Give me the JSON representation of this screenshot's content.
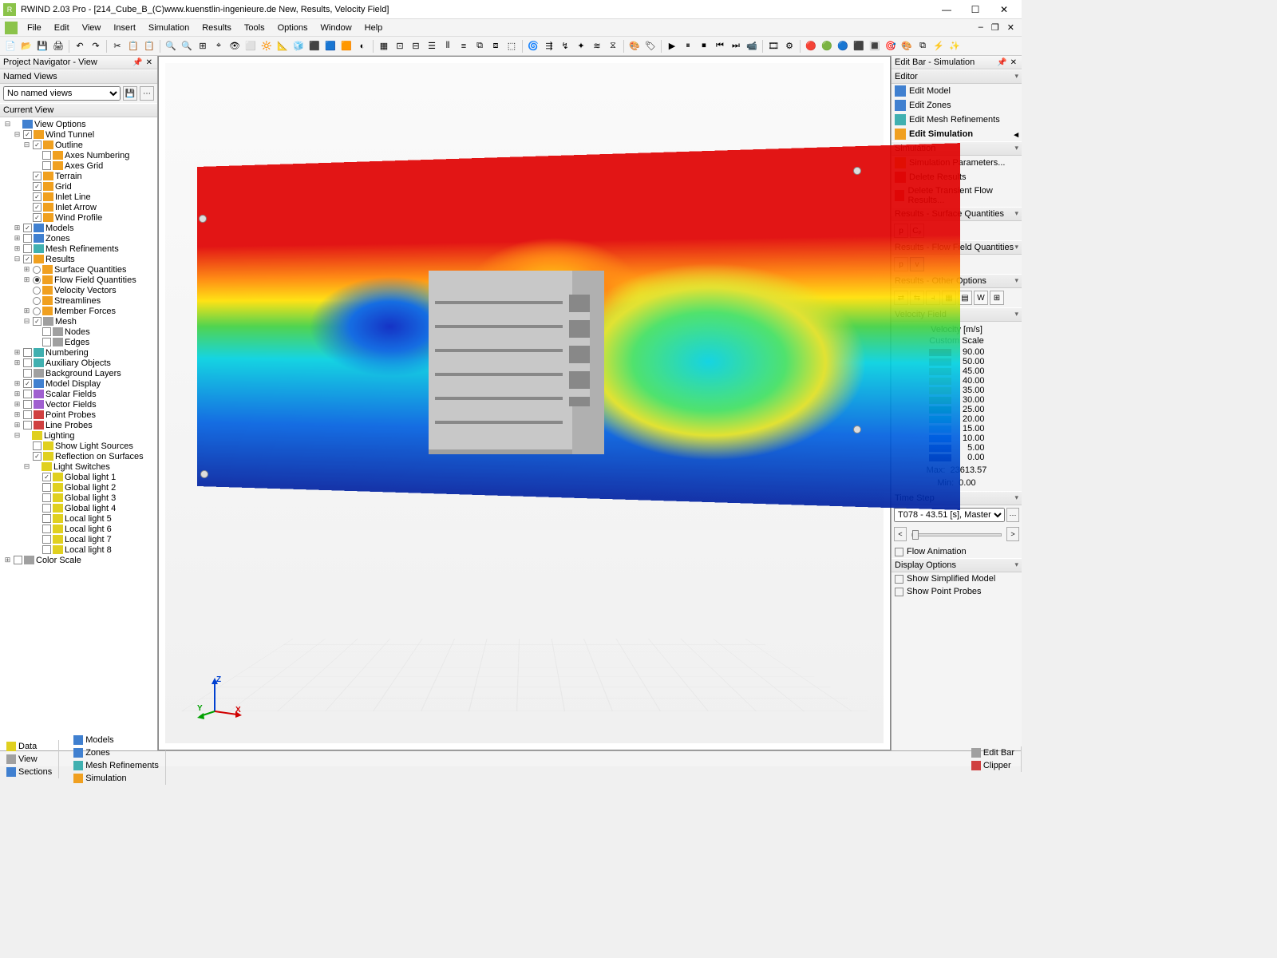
{
  "title": "RWIND 2.03 Pro - [214_Cube_B_(C)www.kuenstlin-ingenieure.de New, Results, Velocity Field]",
  "menu": [
    "File",
    "Edit",
    "View",
    "Insert",
    "Simulation",
    "Results",
    "Tools",
    "Options",
    "Window",
    "Help"
  ],
  "left": {
    "panel_title": "Project Navigator - View",
    "named_views_header": "Named Views",
    "named_views_value": "No named views",
    "current_view_header": "Current View",
    "tree": [
      {
        "ind": 0,
        "exp": "-",
        "cb": null,
        "ic": "ic-blue",
        "lbl": "View Options"
      },
      {
        "ind": 1,
        "exp": "-",
        "cb": true,
        "ic": "ic-orange",
        "lbl": "Wind Tunnel"
      },
      {
        "ind": 2,
        "exp": "-",
        "cb": true,
        "ic": "ic-orange",
        "lbl": "Outline"
      },
      {
        "ind": 3,
        "exp": "",
        "cb": false,
        "ic": "ic-orange",
        "lbl": "Axes Numbering"
      },
      {
        "ind": 3,
        "exp": "",
        "cb": false,
        "ic": "ic-orange",
        "lbl": "Axes Grid"
      },
      {
        "ind": 2,
        "exp": "",
        "cb": true,
        "ic": "ic-orange",
        "lbl": "Terrain"
      },
      {
        "ind": 2,
        "exp": "",
        "cb": true,
        "ic": "ic-orange",
        "lbl": "Grid"
      },
      {
        "ind": 2,
        "exp": "",
        "cb": true,
        "ic": "ic-orange",
        "lbl": "Inlet Line"
      },
      {
        "ind": 2,
        "exp": "",
        "cb": true,
        "ic": "ic-orange",
        "lbl": "Inlet Arrow"
      },
      {
        "ind": 2,
        "exp": "",
        "cb": true,
        "ic": "ic-orange",
        "lbl": "Wind Profile"
      },
      {
        "ind": 1,
        "exp": "+",
        "cb": true,
        "ic": "ic-blue",
        "lbl": "Models"
      },
      {
        "ind": 1,
        "exp": "+",
        "cb": false,
        "ic": "ic-blue",
        "lbl": "Zones"
      },
      {
        "ind": 1,
        "exp": "+",
        "cb": false,
        "ic": "ic-teal",
        "lbl": "Mesh Refinements"
      },
      {
        "ind": 1,
        "exp": "-",
        "cb": true,
        "ic": "ic-orange",
        "lbl": "Results"
      },
      {
        "ind": 2,
        "exp": "+",
        "rb": false,
        "ic": "ic-orange",
        "lbl": "Surface Quantities"
      },
      {
        "ind": 2,
        "exp": "+",
        "rb": true,
        "ic": "ic-orange",
        "lbl": "Flow Field Quantities"
      },
      {
        "ind": 2,
        "exp": "",
        "rb": false,
        "ic": "ic-orange",
        "lbl": "Velocity Vectors"
      },
      {
        "ind": 2,
        "exp": "",
        "rb": false,
        "ic": "ic-orange",
        "lbl": "Streamlines"
      },
      {
        "ind": 2,
        "exp": "+",
        "rb": false,
        "ic": "ic-orange",
        "lbl": "Member Forces"
      },
      {
        "ind": 2,
        "exp": "-",
        "cb": true,
        "ic": "ic-gray",
        "lbl": "Mesh"
      },
      {
        "ind": 3,
        "exp": "",
        "cb": false,
        "ic": "ic-gray",
        "lbl": "Nodes"
      },
      {
        "ind": 3,
        "exp": "",
        "cb": false,
        "ic": "ic-gray",
        "lbl": "Edges"
      },
      {
        "ind": 1,
        "exp": "+",
        "cb": false,
        "ic": "ic-teal",
        "lbl": "Numbering"
      },
      {
        "ind": 1,
        "exp": "+",
        "cb": false,
        "ic": "ic-teal",
        "lbl": "Auxiliary Objects"
      },
      {
        "ind": 1,
        "exp": "",
        "cb": false,
        "ic": "ic-gray",
        "lbl": "Background Layers"
      },
      {
        "ind": 1,
        "exp": "+",
        "cb": true,
        "ic": "ic-blue",
        "lbl": "Model Display"
      },
      {
        "ind": 1,
        "exp": "+",
        "cb": false,
        "ic": "ic-purple",
        "lbl": "Scalar Fields"
      },
      {
        "ind": 1,
        "exp": "+",
        "cb": false,
        "ic": "ic-purple",
        "lbl": "Vector Fields"
      },
      {
        "ind": 1,
        "exp": "+",
        "cb": false,
        "ic": "ic-red",
        "lbl": "Point Probes"
      },
      {
        "ind": 1,
        "exp": "+",
        "cb": false,
        "ic": "ic-red",
        "lbl": "Line Probes"
      },
      {
        "ind": 1,
        "exp": "-",
        "cb": null,
        "ic": "ic-yellow",
        "lbl": "Lighting"
      },
      {
        "ind": 2,
        "exp": "",
        "cb": false,
        "ic": "ic-yellow",
        "lbl": "Show Light Sources"
      },
      {
        "ind": 2,
        "exp": "",
        "cb": true,
        "ic": "ic-yellow",
        "lbl": "Reflection on Surfaces"
      },
      {
        "ind": 2,
        "exp": "-",
        "cb": null,
        "ic": "ic-yellow",
        "lbl": "Light Switches"
      },
      {
        "ind": 3,
        "exp": "",
        "cb": true,
        "ic": "ic-yellow",
        "lbl": "Global light 1"
      },
      {
        "ind": 3,
        "exp": "",
        "cb": false,
        "ic": "ic-yellow",
        "lbl": "Global light 2"
      },
      {
        "ind": 3,
        "exp": "",
        "cb": false,
        "ic": "ic-yellow",
        "lbl": "Global light 3"
      },
      {
        "ind": 3,
        "exp": "",
        "cb": false,
        "ic": "ic-yellow",
        "lbl": "Global light 4"
      },
      {
        "ind": 3,
        "exp": "",
        "cb": false,
        "ic": "ic-yellow",
        "lbl": "Local light 5"
      },
      {
        "ind": 3,
        "exp": "",
        "cb": false,
        "ic": "ic-yellow",
        "lbl": "Local light 6"
      },
      {
        "ind": 3,
        "exp": "",
        "cb": false,
        "ic": "ic-yellow",
        "lbl": "Local light 7"
      },
      {
        "ind": 3,
        "exp": "",
        "cb": false,
        "ic": "ic-yellow",
        "lbl": "Local light 8"
      },
      {
        "ind": 0,
        "exp": "+",
        "cb": false,
        "ic": "ic-gray",
        "lbl": "Color Scale"
      }
    ]
  },
  "right": {
    "panel_title": "Edit Bar - Simulation",
    "editor_header": "Editor",
    "editor_links": [
      {
        "lbl": "Edit Model",
        "ic": "ic-blue"
      },
      {
        "lbl": "Edit Zones",
        "ic": "ic-blue"
      },
      {
        "lbl": "Edit Mesh Refinements",
        "ic": "ic-teal"
      },
      {
        "lbl": "Edit Simulation",
        "ic": "ic-orange",
        "bold": true,
        "caret": true
      }
    ],
    "sim_header": "Simulation",
    "sim_links": [
      {
        "lbl": "Simulation Parameters...",
        "ic": "ic-orange"
      },
      {
        "lbl": "Delete Results",
        "ic": "ic-red"
      },
      {
        "lbl": "Delete Transient Flow Results...",
        "ic": "ic-red"
      }
    ],
    "rsq_header": "Results - Surface Quantities",
    "rsq_buttons": [
      "p",
      "Cₚ"
    ],
    "rff_header": "Results - Flow Field Quantities",
    "rff_buttons": [
      "p",
      "v"
    ],
    "rff_active": "v",
    "roo_header": "Results - Other Options",
    "vf_header": "Velocity Field",
    "legend_title": "Velocity [m/s]",
    "legend_subtitle": "Custom Scale",
    "legend": [
      {
        "c": "#b00000",
        "v": "90.00"
      },
      {
        "c": "#e04000",
        "v": "50.00"
      },
      {
        "c": "#f08000",
        "v": "45.00"
      },
      {
        "c": "#f0c000",
        "v": "40.00"
      },
      {
        "c": "#e0e000",
        "v": "35.00"
      },
      {
        "c": "#80d000",
        "v": "30.00"
      },
      {
        "c": "#00c040",
        "v": "25.00"
      },
      {
        "c": "#00d0c0",
        "v": "20.00"
      },
      {
        "c": "#40c0f0",
        "v": "15.00"
      },
      {
        "c": "#0060f0",
        "v": "10.00"
      },
      {
        "c": "#0020c0",
        "v": "5.00"
      },
      {
        "c": "#000080",
        "v": "0.00"
      }
    ],
    "legend_max_lbl": "Max:",
    "legend_max_val": "23613.57",
    "legend_min_lbl": "Min:",
    "legend_min_val": "0.00",
    "ts_header": "Time Step",
    "ts_value": "T078 - 43.51 [s], Master",
    "flow_anim": "Flow Animation",
    "do_header": "Display Options",
    "do_simplified": "Show Simplified Model",
    "do_probes": "Show Point Probes"
  },
  "bottom": {
    "left_tabs": [
      {
        "lbl": "Data",
        "ic": "ic-yellow"
      },
      {
        "lbl": "View",
        "ic": "ic-gray"
      },
      {
        "lbl": "Sections",
        "ic": "ic-blue"
      }
    ],
    "mid_tabs": [
      {
        "lbl": "Models",
        "ic": "ic-blue"
      },
      {
        "lbl": "Zones",
        "ic": "ic-blue"
      },
      {
        "lbl": "Mesh Refinements",
        "ic": "ic-teal"
      },
      {
        "lbl": "Simulation",
        "ic": "ic-orange"
      }
    ],
    "right_tabs": [
      {
        "lbl": "Edit Bar",
        "ic": "ic-gray"
      },
      {
        "lbl": "Clipper",
        "ic": "ic-red"
      }
    ]
  },
  "axis": {
    "x": "X",
    "y": "Y",
    "z": "Z"
  }
}
